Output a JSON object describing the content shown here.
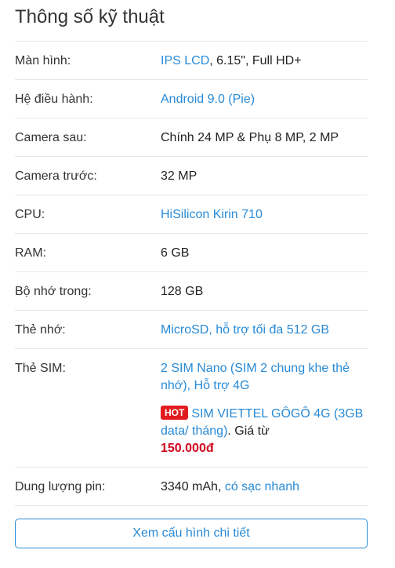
{
  "title": "Thông số kỹ thuật",
  "specs": [
    {
      "label": "Màn hình:",
      "link": "IPS LCD",
      "text": ", 6.15\", Full HD+"
    },
    {
      "label": "Hệ điều hành:",
      "link": "Android 9.0 (Pie)",
      "text": ""
    },
    {
      "label": "Camera sau:",
      "link": "",
      "text": "Chính 24 MP & Phụ 8 MP, 2 MP"
    },
    {
      "label": "Camera trước:",
      "link": "",
      "text": "32 MP"
    },
    {
      "label": "CPU:",
      "link": "HiSilicon Kirin 710",
      "text": ""
    },
    {
      "label": "RAM:",
      "link": "",
      "text": "6 GB"
    },
    {
      "label": "Bộ nhớ trong:",
      "link": "",
      "text": "128 GB"
    },
    {
      "label": "Thẻ nhớ:",
      "link": "MicroSD, hỗ trợ tối đa 512 GB",
      "text": ""
    },
    {
      "label": "Thẻ SIM:",
      "link": "2 SIM Nano (SIM 2 chung khe thẻ nhớ), Hỗ trợ 4G",
      "text": ""
    },
    {
      "label": "Dung lượng pin:",
      "link": "có sạc nhanh",
      "text": "3340 mAh, "
    }
  ],
  "sim_promo": {
    "badge": "HOT",
    "link": "SIM VIETTEL GÔGÔ 4G (3GB data/ tháng)",
    "text": ". Giá từ",
    "price": "150.000đ"
  },
  "button_label": "Xem cấu hình chi tiết",
  "colors": {
    "link": "#288ad6",
    "hot": "#e11b1e",
    "price": "#d0021b"
  }
}
